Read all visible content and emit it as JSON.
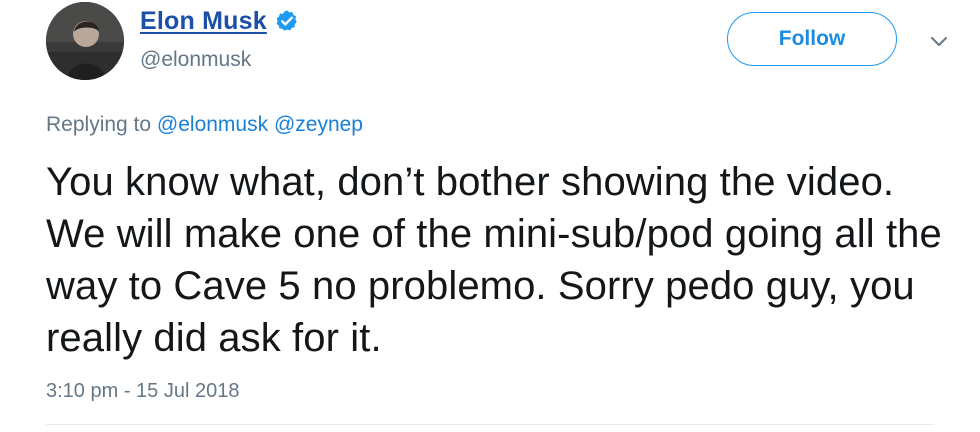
{
  "user": {
    "display_name": "Elon Musk",
    "handle": "@elonmusk",
    "verified_icon": "verified-badge-icon",
    "avatar_icon": "profile-photo"
  },
  "actions": {
    "follow_label": "Follow",
    "menu_icon": "chevron-down-icon"
  },
  "reply": {
    "prefix": "Replying to",
    "mentions": [
      "@elonmusk",
      "@zeynep"
    ]
  },
  "tweet": {
    "text": "You know what, don’t bother showing the video. We will make one of the mini-sub/pod going all the way to Cave 5 no problemo. Sorry pedo guy, you really did ask for it.",
    "timestamp": "3:10 pm - 15 Jul 2018"
  },
  "colors": {
    "name": "#1b4fa8",
    "accent": "#1d9bf0",
    "muted": "#657786",
    "text": "#14171a"
  }
}
